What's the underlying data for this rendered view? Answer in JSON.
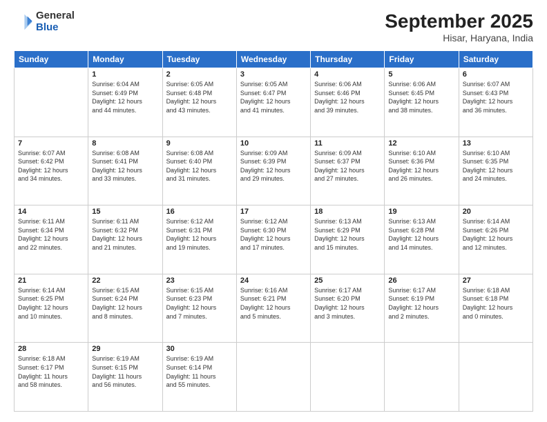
{
  "header": {
    "logo_general": "General",
    "logo_blue": "Blue",
    "title": "September 2025",
    "subtitle": "Hisar, Haryana, India"
  },
  "days_of_week": [
    "Sunday",
    "Monday",
    "Tuesday",
    "Wednesday",
    "Thursday",
    "Friday",
    "Saturday"
  ],
  "weeks": [
    [
      {
        "day": "",
        "info": ""
      },
      {
        "day": "1",
        "info": "Sunrise: 6:04 AM\nSunset: 6:49 PM\nDaylight: 12 hours\nand 44 minutes."
      },
      {
        "day": "2",
        "info": "Sunrise: 6:05 AM\nSunset: 6:48 PM\nDaylight: 12 hours\nand 43 minutes."
      },
      {
        "day": "3",
        "info": "Sunrise: 6:05 AM\nSunset: 6:47 PM\nDaylight: 12 hours\nand 41 minutes."
      },
      {
        "day": "4",
        "info": "Sunrise: 6:06 AM\nSunset: 6:46 PM\nDaylight: 12 hours\nand 39 minutes."
      },
      {
        "day": "5",
        "info": "Sunrise: 6:06 AM\nSunset: 6:45 PM\nDaylight: 12 hours\nand 38 minutes."
      },
      {
        "day": "6",
        "info": "Sunrise: 6:07 AM\nSunset: 6:43 PM\nDaylight: 12 hours\nand 36 minutes."
      }
    ],
    [
      {
        "day": "7",
        "info": "Sunrise: 6:07 AM\nSunset: 6:42 PM\nDaylight: 12 hours\nand 34 minutes."
      },
      {
        "day": "8",
        "info": "Sunrise: 6:08 AM\nSunset: 6:41 PM\nDaylight: 12 hours\nand 33 minutes."
      },
      {
        "day": "9",
        "info": "Sunrise: 6:08 AM\nSunset: 6:40 PM\nDaylight: 12 hours\nand 31 minutes."
      },
      {
        "day": "10",
        "info": "Sunrise: 6:09 AM\nSunset: 6:39 PM\nDaylight: 12 hours\nand 29 minutes."
      },
      {
        "day": "11",
        "info": "Sunrise: 6:09 AM\nSunset: 6:37 PM\nDaylight: 12 hours\nand 27 minutes."
      },
      {
        "day": "12",
        "info": "Sunrise: 6:10 AM\nSunset: 6:36 PM\nDaylight: 12 hours\nand 26 minutes."
      },
      {
        "day": "13",
        "info": "Sunrise: 6:10 AM\nSunset: 6:35 PM\nDaylight: 12 hours\nand 24 minutes."
      }
    ],
    [
      {
        "day": "14",
        "info": "Sunrise: 6:11 AM\nSunset: 6:34 PM\nDaylight: 12 hours\nand 22 minutes."
      },
      {
        "day": "15",
        "info": "Sunrise: 6:11 AM\nSunset: 6:32 PM\nDaylight: 12 hours\nand 21 minutes."
      },
      {
        "day": "16",
        "info": "Sunrise: 6:12 AM\nSunset: 6:31 PM\nDaylight: 12 hours\nand 19 minutes."
      },
      {
        "day": "17",
        "info": "Sunrise: 6:12 AM\nSunset: 6:30 PM\nDaylight: 12 hours\nand 17 minutes."
      },
      {
        "day": "18",
        "info": "Sunrise: 6:13 AM\nSunset: 6:29 PM\nDaylight: 12 hours\nand 15 minutes."
      },
      {
        "day": "19",
        "info": "Sunrise: 6:13 AM\nSunset: 6:28 PM\nDaylight: 12 hours\nand 14 minutes."
      },
      {
        "day": "20",
        "info": "Sunrise: 6:14 AM\nSunset: 6:26 PM\nDaylight: 12 hours\nand 12 minutes."
      }
    ],
    [
      {
        "day": "21",
        "info": "Sunrise: 6:14 AM\nSunset: 6:25 PM\nDaylight: 12 hours\nand 10 minutes."
      },
      {
        "day": "22",
        "info": "Sunrise: 6:15 AM\nSunset: 6:24 PM\nDaylight: 12 hours\nand 8 minutes."
      },
      {
        "day": "23",
        "info": "Sunrise: 6:15 AM\nSunset: 6:23 PM\nDaylight: 12 hours\nand 7 minutes."
      },
      {
        "day": "24",
        "info": "Sunrise: 6:16 AM\nSunset: 6:21 PM\nDaylight: 12 hours\nand 5 minutes."
      },
      {
        "day": "25",
        "info": "Sunrise: 6:17 AM\nSunset: 6:20 PM\nDaylight: 12 hours\nand 3 minutes."
      },
      {
        "day": "26",
        "info": "Sunrise: 6:17 AM\nSunset: 6:19 PM\nDaylight: 12 hours\nand 2 minutes."
      },
      {
        "day": "27",
        "info": "Sunrise: 6:18 AM\nSunset: 6:18 PM\nDaylight: 12 hours\nand 0 minutes."
      }
    ],
    [
      {
        "day": "28",
        "info": "Sunrise: 6:18 AM\nSunset: 6:17 PM\nDaylight: 11 hours\nand 58 minutes."
      },
      {
        "day": "29",
        "info": "Sunrise: 6:19 AM\nSunset: 6:15 PM\nDaylight: 11 hours\nand 56 minutes."
      },
      {
        "day": "30",
        "info": "Sunrise: 6:19 AM\nSunset: 6:14 PM\nDaylight: 11 hours\nand 55 minutes."
      },
      {
        "day": "",
        "info": ""
      },
      {
        "day": "",
        "info": ""
      },
      {
        "day": "",
        "info": ""
      },
      {
        "day": "",
        "info": ""
      }
    ]
  ]
}
